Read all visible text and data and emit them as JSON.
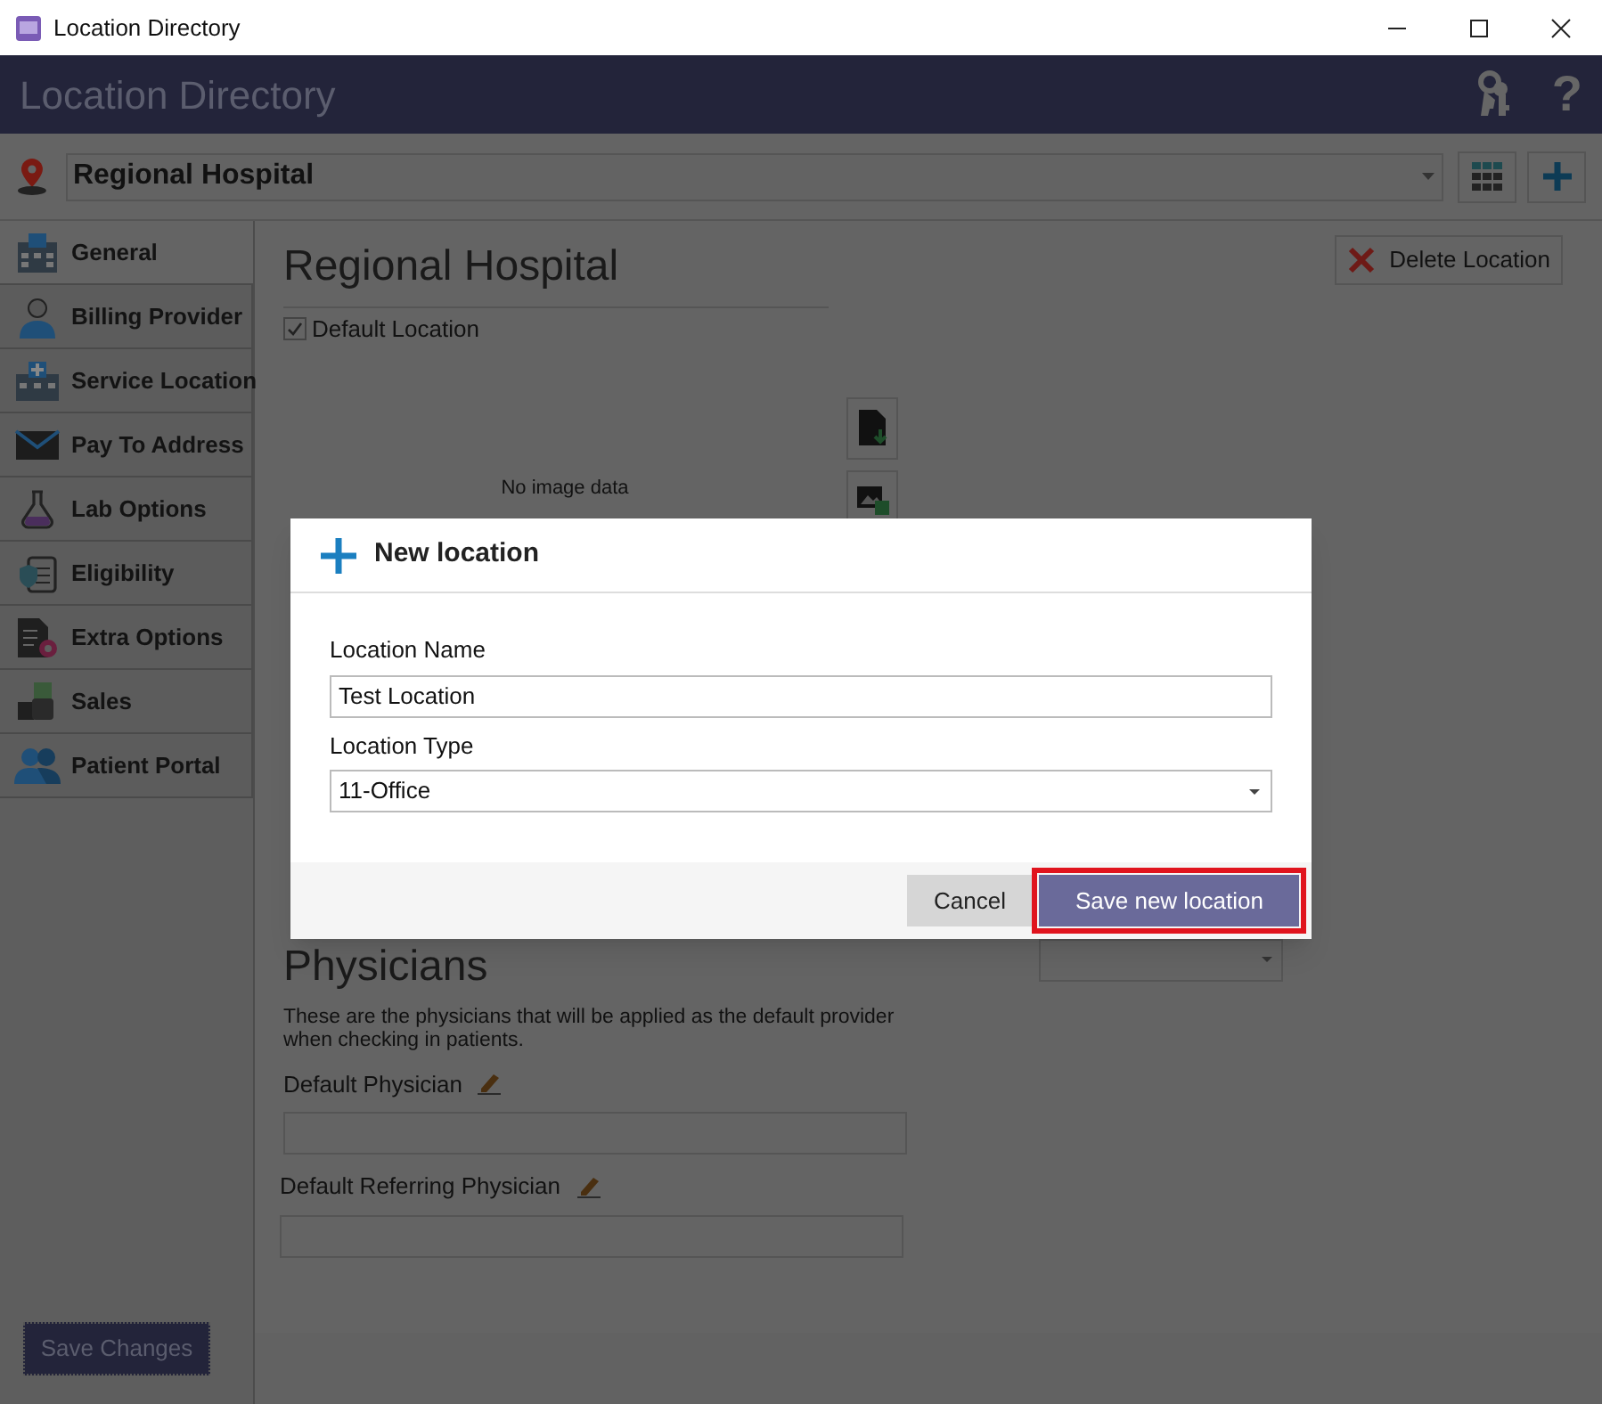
{
  "window": {
    "title": "Location Directory"
  },
  "header": {
    "title": "Location Directory",
    "help_button": "?"
  },
  "location_selector": {
    "value": "Regional Hospital"
  },
  "sidebar": {
    "items": [
      {
        "label": "General",
        "selected": true
      },
      {
        "label": "Billing Provider",
        "selected": false
      },
      {
        "label": "Service Location",
        "selected": false
      },
      {
        "label": "Pay To Address",
        "selected": false
      },
      {
        "label": "Lab Options",
        "selected": false
      },
      {
        "label": "Eligibility",
        "selected": false
      },
      {
        "label": "Extra Options",
        "selected": false
      },
      {
        "label": "Sales",
        "selected": false
      },
      {
        "label": "Patient Portal",
        "selected": false
      }
    ],
    "save_button": "Save Changes"
  },
  "main": {
    "title": "Regional Hospital",
    "default_location": {
      "label": "Default Location",
      "checked": true
    },
    "image_placeholder": "No image data",
    "delete_button": "Delete Location",
    "physicians": {
      "heading": "Physicians",
      "description": "These are the physicians that will be applied as the default provider when checking in patients.",
      "fields": [
        {
          "label": "Default Physician"
        },
        {
          "label": "Default Referring Physician"
        }
      ]
    }
  },
  "dialog": {
    "title": "New location",
    "fields": [
      {
        "kind": "text",
        "label": "Location Name",
        "value": "Test Location"
      },
      {
        "kind": "select",
        "label": "Location Type",
        "value": "11-Office"
      }
    ],
    "buttons": [
      {
        "kind": "secondary",
        "label": "Cancel",
        "highlighted": false
      },
      {
        "kind": "primary",
        "label": "Save new location",
        "highlighted": true
      }
    ]
  }
}
